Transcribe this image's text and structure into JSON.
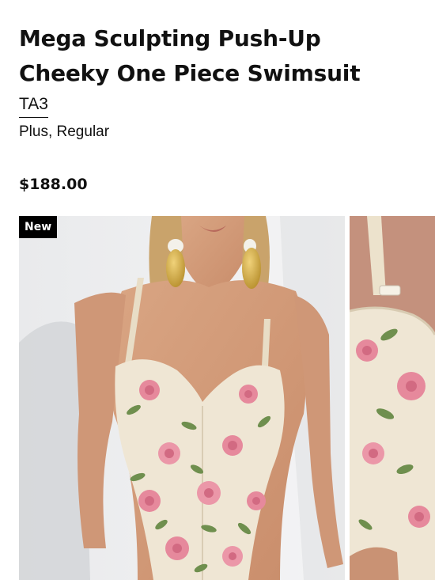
{
  "product": {
    "title": "Mega Sculpting Push-Up Cheeky One Piece Swimsuit",
    "brand": "TA3",
    "size_options": "Plus, Regular",
    "price": "$188.00"
  },
  "gallery": {
    "badge": "New",
    "images": [
      {
        "subject": "model-wearing-floral-swimsuit-front"
      },
      {
        "subject": "swimsuit-strap-closeup"
      }
    ]
  },
  "colors": {
    "badge_bg": "#000000",
    "swimsuit_base": "#efe6d4",
    "rose_pink": "#e6899c",
    "leaf_green": "#6f8f4e"
  }
}
